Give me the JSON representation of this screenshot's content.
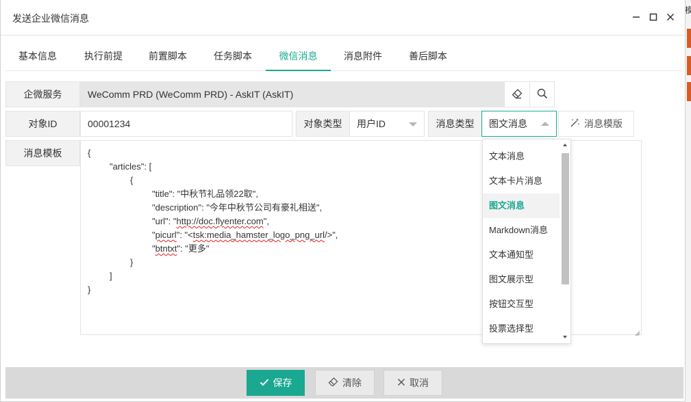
{
  "dialog": {
    "title": "发送企业微信消息"
  },
  "tabs": [
    {
      "label": "基本信息"
    },
    {
      "label": "执行前提"
    },
    {
      "label": "前置脚本"
    },
    {
      "label": "任务脚本"
    },
    {
      "label": "微信消息"
    },
    {
      "label": "消息附件"
    },
    {
      "label": "善后脚本"
    }
  ],
  "active_tab": "微信消息",
  "form": {
    "service_label": "企微服务",
    "service_value": "WeComm PRD (WeComm PRD) - AskIT (AskIT)",
    "target_id_label": "对象ID",
    "target_id_value": "00001234",
    "target_type_label": "对象类型",
    "target_type_value": "用户ID",
    "msg_type_label": "消息类型",
    "msg_type_value": "图文消息",
    "template_button": "消息模版",
    "template_label": "消息模板"
  },
  "template_text": {
    "l1": "{",
    "l2": "\"articles\": [",
    "l3": "{",
    "l4": "\"title\": \"中秋节礼品领22取\",",
    "l5": "\"description\": \"今年中秋节公司有豪礼相送\",",
    "l6a": "\"url\": \"",
    "l6b": "http://doc.flyenter.com",
    "l6c": "\",",
    "l7a": "\"",
    "l7b": "picurl",
    "l7c": "\": \"<",
    "l7d": "tsk:media_hamster_logo_png_url",
    "l7e": "/>\",",
    "l8a": "\"",
    "l8b": "btntxt",
    "l8c": "\": \"更多\"",
    "l9": "}",
    "l10": "]",
    "l11": "}"
  },
  "dropdown": {
    "items": [
      {
        "label": "文本消息"
      },
      {
        "label": "文本卡片消息"
      },
      {
        "label": "图文消息"
      },
      {
        "label": "Markdown消息"
      },
      {
        "label": "文本通知型"
      },
      {
        "label": "图文展示型"
      },
      {
        "label": "按钮交互型"
      },
      {
        "label": "投票选择型"
      }
    ],
    "selected": "图文消息"
  },
  "footer": {
    "save": "保存",
    "clear": "清除",
    "cancel": "取消"
  },
  "background": {
    "edge_text": "模"
  },
  "colors": {
    "accent": "#1aa891",
    "edge_marks": "#d95b24"
  }
}
